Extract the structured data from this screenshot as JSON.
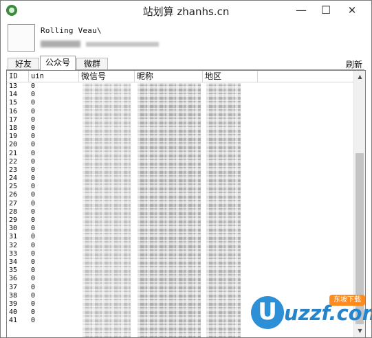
{
  "window": {
    "title": "站划算 zhanhs.cn",
    "min_glyph": "—",
    "max_glyph": "☐",
    "close_glyph": "✕"
  },
  "profile": {
    "name": "Rolling Veau\\"
  },
  "tabs": [
    {
      "label": "好友",
      "active": false
    },
    {
      "label": "公众号",
      "active": true
    },
    {
      "label": "微群",
      "active": false
    }
  ],
  "refresh_label": "刷新",
  "table": {
    "columns": [
      "ID",
      "uin",
      "微信号",
      "昵称",
      "地区"
    ],
    "rows": [
      {
        "id": "13",
        "uin": "0"
      },
      {
        "id": "14",
        "uin": "0"
      },
      {
        "id": "15",
        "uin": "0"
      },
      {
        "id": "16",
        "uin": "0"
      },
      {
        "id": "17",
        "uin": "0"
      },
      {
        "id": "18",
        "uin": "0"
      },
      {
        "id": "19",
        "uin": "0"
      },
      {
        "id": "20",
        "uin": "0"
      },
      {
        "id": "21",
        "uin": "0"
      },
      {
        "id": "22",
        "uin": "0"
      },
      {
        "id": "23",
        "uin": "0"
      },
      {
        "id": "24",
        "uin": "0"
      },
      {
        "id": "25",
        "uin": "0"
      },
      {
        "id": "26",
        "uin": "0"
      },
      {
        "id": "27",
        "uin": "0"
      },
      {
        "id": "28",
        "uin": "0"
      },
      {
        "id": "29",
        "uin": "0"
      },
      {
        "id": "30",
        "uin": "0"
      },
      {
        "id": "31",
        "uin": "0"
      },
      {
        "id": "32",
        "uin": "0"
      },
      {
        "id": "33",
        "uin": "0"
      },
      {
        "id": "34",
        "uin": "0"
      },
      {
        "id": "35",
        "uin": "0"
      },
      {
        "id": "36",
        "uin": "0"
      },
      {
        "id": "37",
        "uin": "0"
      },
      {
        "id": "38",
        "uin": "0"
      },
      {
        "id": "39",
        "uin": "0"
      },
      {
        "id": "40",
        "uin": "0"
      },
      {
        "id": "41",
        "uin": "0"
      }
    ]
  },
  "scrollbar": {
    "up_glyph": "▲",
    "down_glyph": "▼"
  },
  "watermark": {
    "text": "uzzf.com",
    "logo_letter": "U",
    "badge": "东坡下载"
  },
  "colors": {
    "accent": "#2d8fd6",
    "badge": "#ff8a1e",
    "border": "#828282"
  }
}
